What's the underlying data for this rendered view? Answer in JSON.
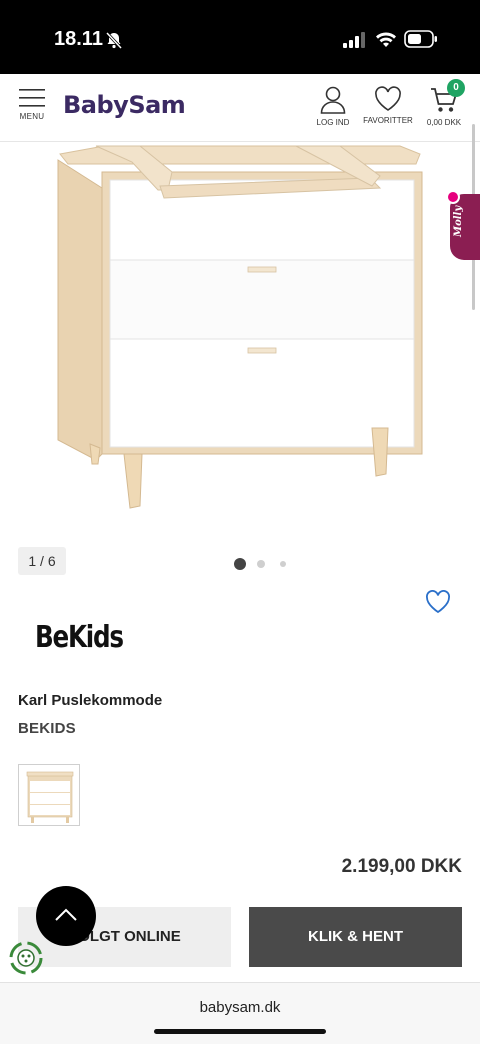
{
  "status_bar": {
    "time": "18.11"
  },
  "header": {
    "logo": "BabySam",
    "menu_label": "MENU",
    "login_label": "LOG IND",
    "favorites_label": "FAVORITTER",
    "cart_total": "0,00 DKK",
    "cart_count": "0"
  },
  "chat_widget": {
    "label": "Molly"
  },
  "gallery": {
    "counter": "1 / 6",
    "total_images": 6,
    "current_index": 1
  },
  "product": {
    "brand_logo": "BeKids",
    "title": "Karl Puslekommode",
    "brand": "BEKIDS",
    "price": "2.199,00 DKK"
  },
  "actions": {
    "sold_online_label": "SOLGT ONLINE",
    "click_collect_label": "KLIK & HENT"
  },
  "browser": {
    "url": "babysam.dk"
  },
  "colors": {
    "brand": "#3b2a63",
    "cart_badge": "#1fa463",
    "favorite_heart": "#2a6fc9",
    "molly": "#8b1e52"
  }
}
